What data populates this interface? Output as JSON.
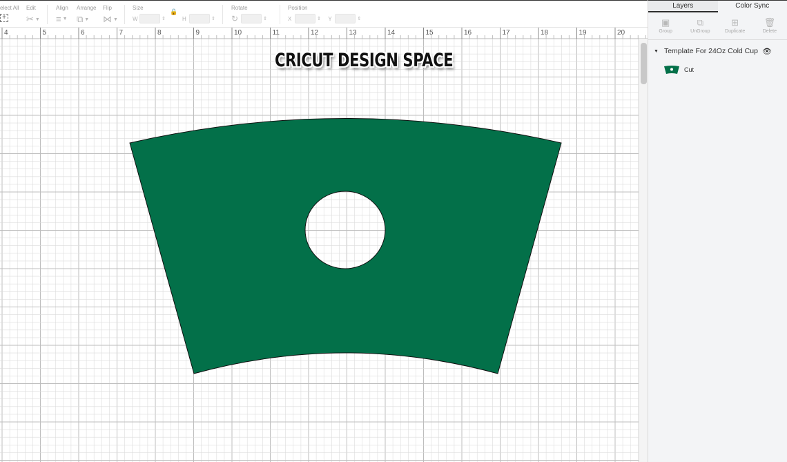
{
  "toolbar": {
    "select_all": "elect All",
    "edit": "Edit",
    "align": "Align",
    "arrange": "Arrange",
    "flip": "Flip",
    "size": "Size",
    "size_w": "W",
    "size_h": "H",
    "rotate": "Rotate",
    "position": "Position",
    "pos_x": "X",
    "pos_y": "Y"
  },
  "ruler": {
    "ticks": [
      "4",
      "5",
      "6",
      "7",
      "8",
      "9",
      "10",
      "11",
      "12",
      "13",
      "14",
      "15",
      "16",
      "17",
      "18",
      "19",
      "20"
    ]
  },
  "canvas": {
    "title": "CRICUT DESIGN SPACE",
    "shape_color": "#037049",
    "grid_color": "#dcdcdc"
  },
  "panel": {
    "tabs": [
      {
        "label": "Layers",
        "active": true
      },
      {
        "label": "Color Sync",
        "active": false
      }
    ],
    "actions": [
      {
        "label": "Group",
        "icon": "group-icon"
      },
      {
        "label": "UnGroup",
        "icon": "ungroup-icon"
      },
      {
        "label": "Duplicate",
        "icon": "duplicate-icon"
      },
      {
        "label": "Delete",
        "icon": "trash-icon"
      }
    ],
    "group_name": "Template For 24Oz Cold Cup",
    "layer_name": "Cut"
  }
}
